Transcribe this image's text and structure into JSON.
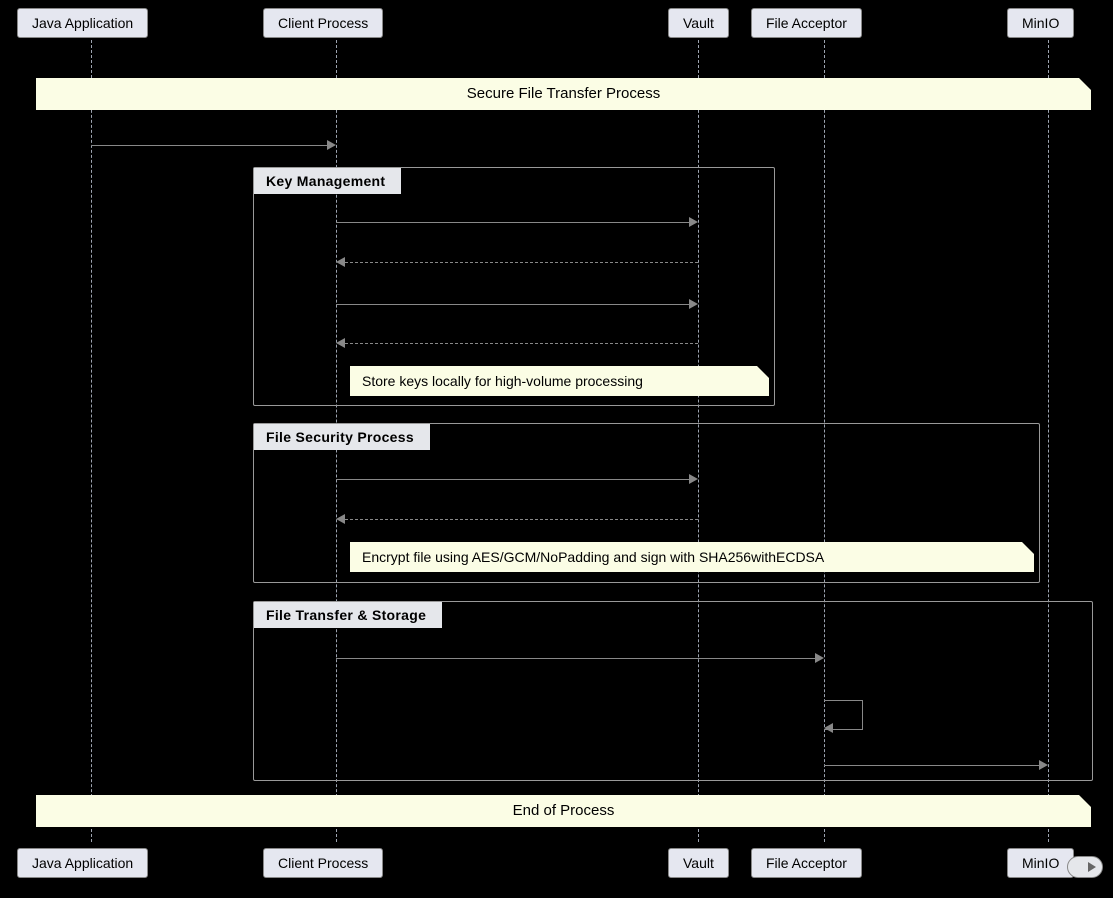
{
  "participants": {
    "java_app": "Java Application",
    "client_process": "Client Process",
    "vault": "Vault",
    "file_acceptor": "File Acceptor",
    "minio": "MinIO"
  },
  "banners": {
    "top": "Secure File Transfer Process",
    "bottom": "End of Process"
  },
  "groups": {
    "g1": "Key Management",
    "g2": "File Security Process",
    "g3": "File Transfer & Storage"
  },
  "notes": {
    "n1": "Store keys locally for high-volume processing",
    "n2": "Encrypt file using AES/GCM/NoPadding and sign with SHA256withECDSA"
  }
}
